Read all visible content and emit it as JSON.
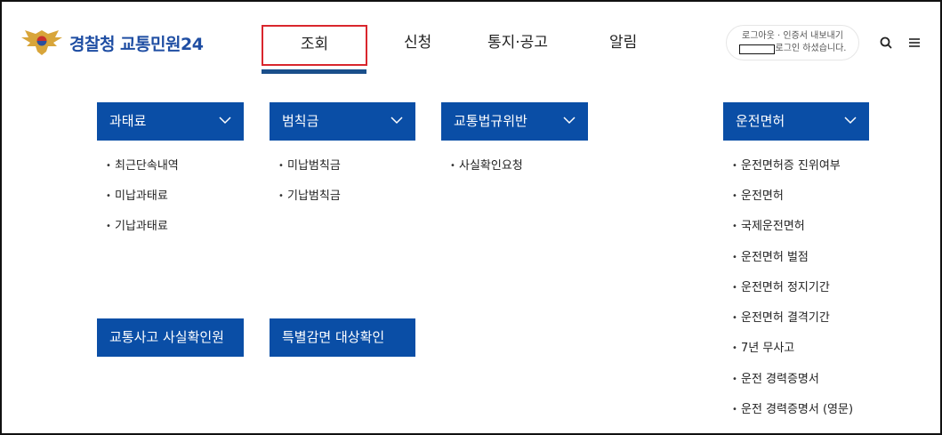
{
  "header": {
    "logo_text": "경찰청 교통민원24",
    "nav": [
      "조회",
      "신청",
      "통지·공고",
      "알림"
    ],
    "util_line1": "로그아웃 · 인증서 내보내기",
    "util_line2": "로그인 하셨습니다."
  },
  "menus": [
    {
      "title": "과태료",
      "items": [
        "최근단속내역",
        "미납과태료",
        "기납과태료"
      ]
    },
    {
      "title": "범칙금",
      "items": [
        "미납범칙금",
        "기납범칙금"
      ]
    },
    {
      "title": "교통법규위반",
      "items": [
        "사실확인요청"
      ]
    },
    {
      "title": "운전면허",
      "items": [
        "운전면허증 진위여부",
        "운전면허",
        "국제운전면허",
        "운전면허 벌점",
        "운전면허 정지기간",
        "운전면허 결격기간",
        "7년 무사고",
        "운전 경력증명서",
        "운전 경력증명서 (영문)"
      ]
    }
  ],
  "buttons": {
    "accident": "교통사고 사실확인원",
    "special": "특별감면 대상확인"
  },
  "colors": {
    "brand_blue": "#0a4ea6",
    "logo_blue": "#1f4ea3",
    "active_border": "#d9262d"
  }
}
